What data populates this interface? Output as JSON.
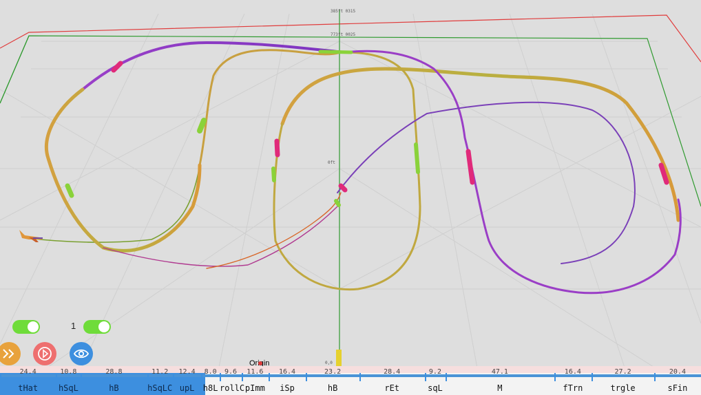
{
  "viewport": {
    "title_top": "385ft 0315",
    "title_mid": "773ft 0025",
    "center_label": "0ft",
    "origin_label": "Origin",
    "marker_label": "0,0"
  },
  "controls": {
    "toggle_left": {
      "state": "on"
    },
    "toggle_count": "1",
    "toggle_right": {
      "state": "on"
    },
    "buttons": [
      {
        "icon": "fast-forward-icon",
        "color": "#e8a23d"
      },
      {
        "icon": "play-icon",
        "color": "#ee6f6f"
      },
      {
        "icon": "eye-icon",
        "color": "#3d8fdf"
      }
    ]
  },
  "timeline": {
    "progress_value": 0.293,
    "segments": [
      {
        "label": "tHat",
        "value": "24.4"
      },
      {
        "label": "hSqL",
        "value": "10.8"
      },
      {
        "label": "hB",
        "value": "28.8"
      },
      {
        "label": "hSqLC",
        "value": "11.2"
      },
      {
        "label": "upL",
        "value": "12.4"
      },
      {
        "label": "h8L",
        "value": "8.0"
      },
      {
        "label": "rollC",
        "value": "9.6"
      },
      {
        "label": "pImm",
        "value": "11.6"
      },
      {
        "label": "iSp",
        "value": "16.4"
      },
      {
        "label": "hB",
        "value": "23.2"
      },
      {
        "label": "rEt",
        "value": "28.4"
      },
      {
        "label": "sqL",
        "value": "9.2"
      },
      {
        "label": "M",
        "value": "47.1"
      },
      {
        "label": "fTrn",
        "value": "16.4"
      },
      {
        "label": "trgle",
        "value": "27.2"
      },
      {
        "label": "sFin",
        "value": "20.4"
      }
    ]
  }
}
